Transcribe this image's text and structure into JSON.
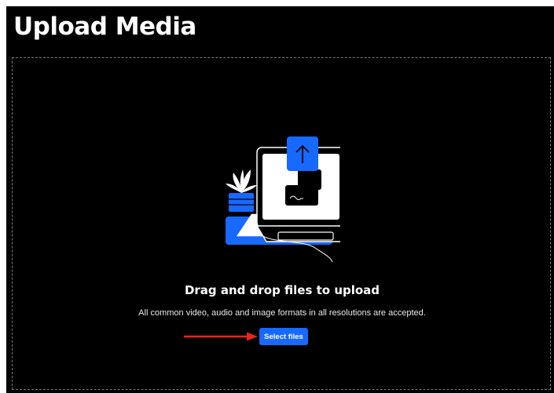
{
  "header": {
    "title": "Upload Media"
  },
  "dropzone": {
    "heading": "Drag and drop files to upload",
    "description": "All common video, audio and image formats in all resolutions are accepted.",
    "select_button_label": "Select files"
  },
  "icons": {
    "illustration": "upload-laptop-illustration",
    "annotation": "red-arrow-icon"
  },
  "colors": {
    "background": "#000000",
    "accent": "#1769ff",
    "annotation": "#e8261b",
    "text": "#ffffff"
  }
}
